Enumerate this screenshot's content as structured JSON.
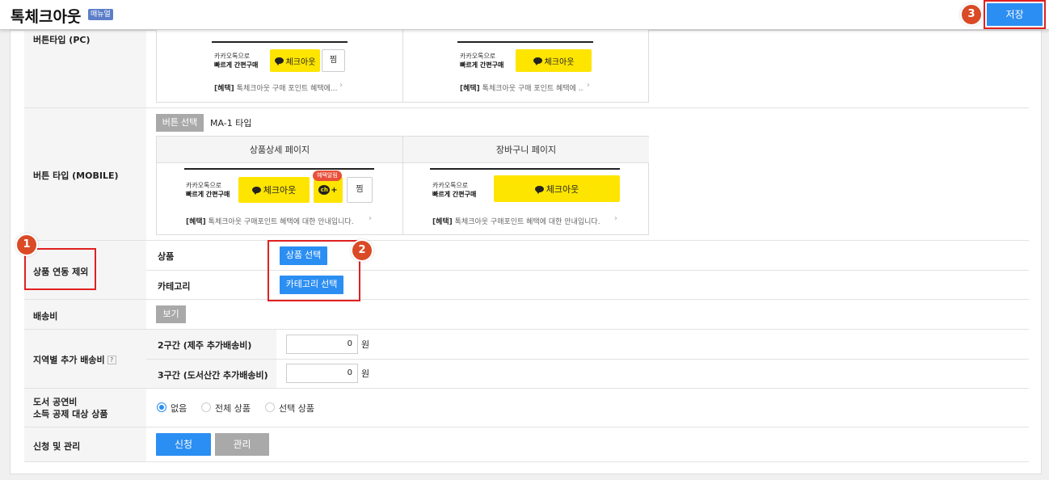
{
  "header": {
    "title": "톡체크아웃",
    "manual_badge": "매뉴얼",
    "save_label": "저장"
  },
  "annotations": {
    "one": "1",
    "two": "2",
    "three": "3"
  },
  "rows": {
    "button_type_pc": {
      "label": "버튼타입 (PC)",
      "left": {
        "kakao_line1": "카카오톡으로",
        "kakao_line2": "빠르게 간편구매",
        "checkout": "체크아웃",
        "zzim": "찜",
        "promo_tag": "[혜택]",
        "promo_text": " 톡체크아웃 구매 포인트 혜택에...",
        "chevron": "›"
      },
      "right": {
        "kakao_line1": "카카오톡으로",
        "kakao_line2": "빠르게 간편구매",
        "checkout": "체크아웃",
        "promo_tag": "[혜택]",
        "promo_text": " 톡체크아웃 구매 포인트 혜택에 ..",
        "chevron": "›"
      }
    },
    "button_type_mobile": {
      "label": "버튼 타입 (MOBILE)",
      "select_button": "버튼 선택",
      "selected_type": "MA-1 타입",
      "col_product": "상품상세 페이지",
      "col_cart": "장바구니 페이지",
      "left": {
        "kakao_line1": "카카오톡으로",
        "kakao_line2": "빠르게 간편구매",
        "checkout": "체크아웃",
        "alert": "혜택알림",
        "ch": "ch",
        "ch_plus": "+",
        "zzim": "찜",
        "promo_tag": "[혜택]",
        "promo_text": " 톡체크아웃 구매포인트 혜택에 대한 안내입니다.",
        "chevron": "›"
      },
      "right": {
        "kakao_line1": "카카오톡으로",
        "kakao_line2": "빠르게 간편구매",
        "checkout": "체크아웃",
        "promo_tag": "[혜택]",
        "promo_text": " 톡체크아웃 구매포인트 혜택에 대한 안내입니다.",
        "chevron": "›"
      }
    },
    "exclude": {
      "label": "상품 연동 제외",
      "product_label": "상품",
      "product_button": "상품 선택",
      "category_label": "카테고리",
      "category_button": "카테고리 선택"
    },
    "shipping": {
      "label": "배송비",
      "view_button": "보기"
    },
    "regional": {
      "label": "지역별 추가 배송비",
      "help": "?",
      "zone2_label": "2구간 (제주 추가배송비)",
      "zone2_value": "0",
      "zone3_label": "3구간 (도서산간 추가배송비)",
      "zone3_value": "0",
      "unit": "원"
    },
    "book_deduction": {
      "label_line1": "도서 공연비",
      "label_line2": "소득 공제 대상 상품",
      "options": [
        "없음",
        "전체 상품",
        "선택 상품"
      ],
      "selected": "없음"
    },
    "apply": {
      "label": "신청 및 관리",
      "apply_button": "신청",
      "manage_button": "관리"
    }
  },
  "colors": {
    "primary": "#2b8ef2",
    "kakao_yellow": "#fee500",
    "annotation_red": "#e02020",
    "badge_orange": "#d94a25"
  }
}
